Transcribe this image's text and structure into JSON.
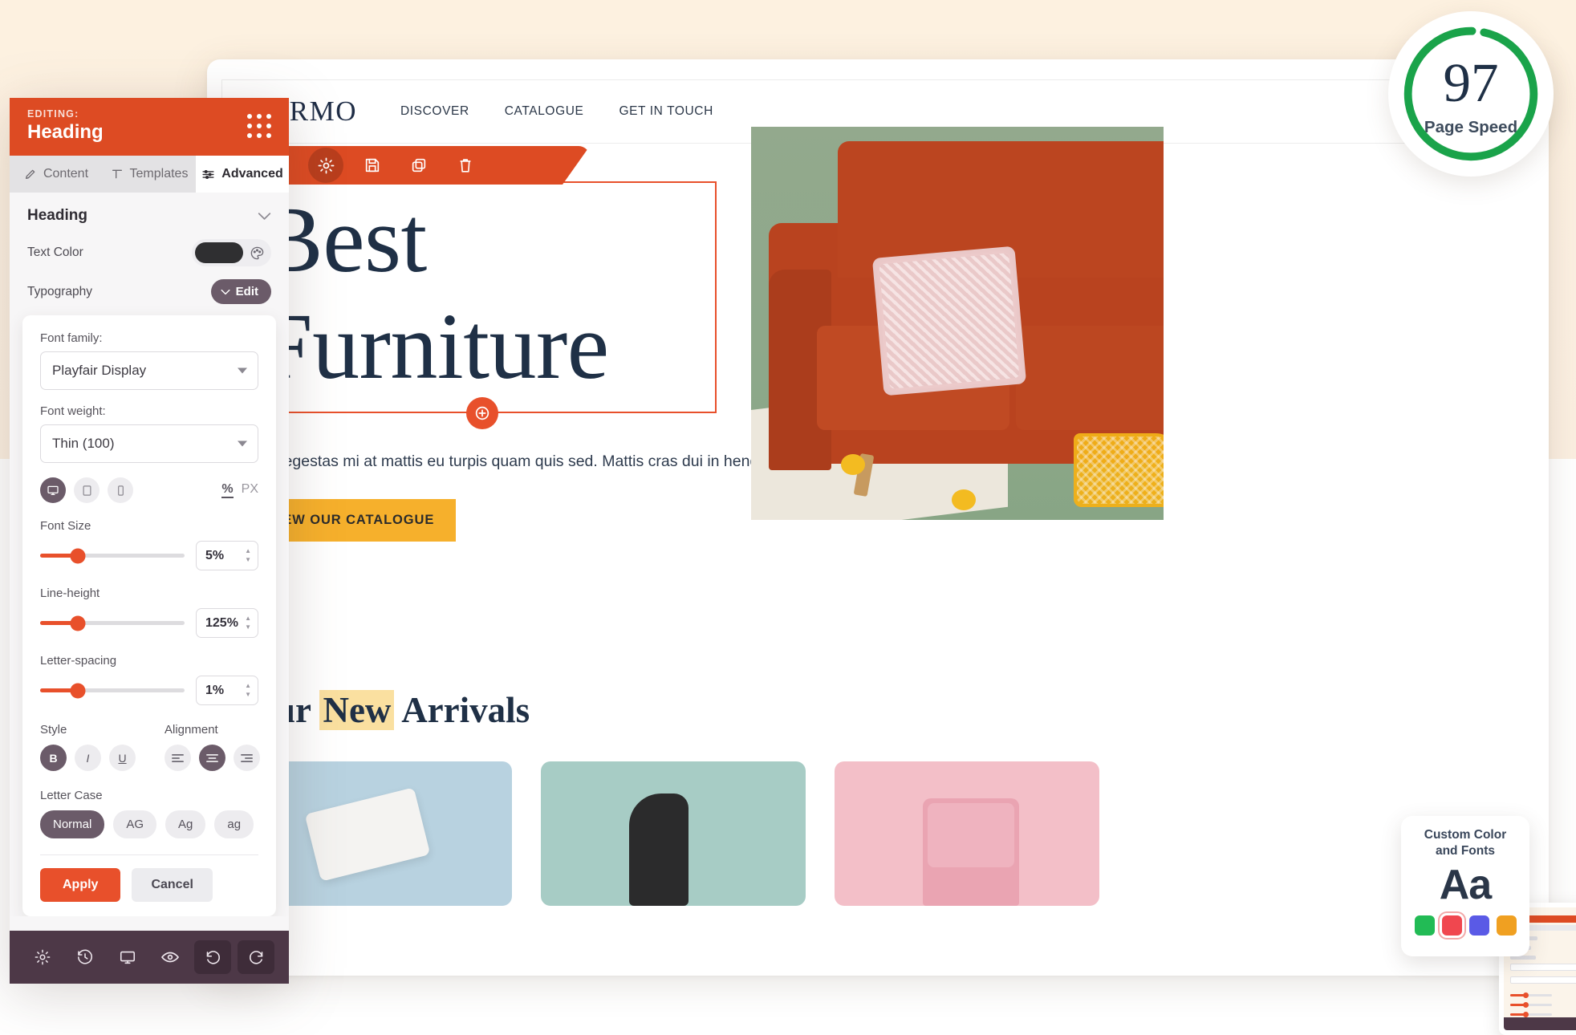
{
  "editor": {
    "editing_label": "EDITING:",
    "element_name": "Heading",
    "grip_icon": "drag-grip-icon",
    "tabs": [
      {
        "label": "Content",
        "icon": "pencil-icon",
        "active": false
      },
      {
        "label": "Templates",
        "icon": "template-icon",
        "active": false
      },
      {
        "label": "Advanced",
        "icon": "sliders-icon",
        "active": true
      }
    ],
    "section": {
      "title": "Heading",
      "collapse_icon": "chevron-down-icon"
    },
    "text_color": {
      "label": "Text Color",
      "value_hex": "#2f2f31",
      "picker_icon": "color-palette-icon"
    },
    "typography": {
      "label": "Typography",
      "edit_button": "Edit",
      "edit_caret_icon": "chevron-down-icon"
    },
    "typography_panel": {
      "font_family_label": "Font family:",
      "font_family_value": "Playfair Display",
      "font_weight_label": "Font weight:",
      "font_weight_value": "Thin (100)",
      "devices": [
        {
          "name": "desktop-icon",
          "active": true
        },
        {
          "name": "tablet-icon",
          "active": false
        },
        {
          "name": "mobile-icon",
          "active": false
        }
      ],
      "units": [
        {
          "label": "%",
          "active": true
        },
        {
          "label": "PX",
          "active": false
        }
      ],
      "sliders": [
        {
          "label": "Font Size",
          "value": "5%",
          "fill_percent": 26
        },
        {
          "label": "Line-height",
          "value": "125%",
          "fill_percent": 26
        },
        {
          "label": "Letter-spacing",
          "value": "1%",
          "fill_percent": 26
        }
      ],
      "style_label": "Style",
      "style_buttons": [
        {
          "label": "B",
          "name": "bold-button",
          "active": true
        },
        {
          "label": "I",
          "name": "italic-button",
          "active": false
        },
        {
          "label": "U",
          "name": "underline-button",
          "active": false
        }
      ],
      "alignment_label": "Alignment",
      "alignment_buttons": [
        {
          "name": "align-left-icon",
          "active": false
        },
        {
          "name": "align-center-icon",
          "active": true
        },
        {
          "name": "align-right-icon",
          "active": false
        }
      ],
      "letter_case_label": "Letter Case",
      "letter_case_options": [
        {
          "label": "Normal",
          "active": true
        },
        {
          "label": "AG",
          "active": false
        },
        {
          "label": "Ag",
          "active": false
        },
        {
          "label": "ag",
          "active": false
        }
      ],
      "apply_label": "Apply",
      "cancel_label": "Cancel"
    },
    "footer_buttons": [
      {
        "name": "settings-gear-icon"
      },
      {
        "name": "history-clock-icon"
      },
      {
        "name": "desktop-preview-icon"
      },
      {
        "name": "eye-preview-icon"
      },
      {
        "name": "undo-icon"
      },
      {
        "name": "redo-icon"
      }
    ]
  },
  "site": {
    "brand": "FURMO",
    "nav_links": [
      "DISCOVER",
      "CATALOGUE",
      "GET IN TOUCH"
    ],
    "search_icon": "search-icon",
    "cart_icon": "shopping-bag-icon",
    "hero": {
      "toolbar_icons": [
        {
          "name": "move-icon",
          "active": false
        },
        {
          "name": "settings-gear-icon",
          "active": true
        },
        {
          "name": "save-icon",
          "active": false
        },
        {
          "name": "duplicate-icon",
          "active": false
        },
        {
          "name": "trash-icon",
          "active": false
        }
      ],
      "heading_line1": "Best",
      "heading_line2": "Furniture",
      "add_handle_icon": "add-circle-icon",
      "paragraph": "Eget egestas mi at mattis eu turpis quam quis sed. Mattis cras dui in hendrerit.",
      "cta_label": "VIEW OUR CATALOGUE",
      "image_alt": "orange-sofa-photo"
    },
    "arrivals": {
      "title_part1": "Our ",
      "title_highlight": "New",
      "title_part2": " Arrivals",
      "cards": [
        {
          "name": "product-card-blue",
          "color": "#b8d2e0"
        },
        {
          "name": "product-card-teal",
          "color": "#a7ccc5"
        },
        {
          "name": "product-card-pink",
          "color": "#f3bfc8"
        }
      ]
    }
  },
  "page_speed": {
    "score": "97",
    "label": "Page Speed",
    "ring_color": "#1aa34a",
    "progress_percent": 97
  },
  "custom_card": {
    "title_line1": "Custom Color",
    "title_line2": "and Fonts",
    "sample_text": "Aa",
    "swatches": [
      {
        "hex": "#22bb55",
        "selected": false
      },
      {
        "hex": "#f0474f",
        "selected": true
      },
      {
        "hex": "#5a5ae6",
        "selected": false
      },
      {
        "hex": "#f0a021",
        "selected": false
      }
    ]
  }
}
